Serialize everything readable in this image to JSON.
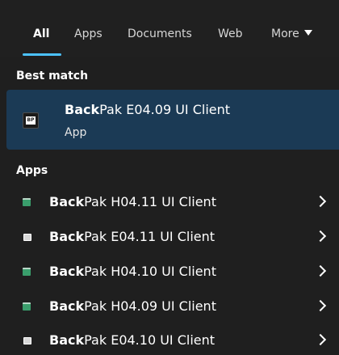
{
  "tabs": [
    {
      "label": "All",
      "active": true
    },
    {
      "label": "Apps",
      "active": false
    },
    {
      "label": "Documents",
      "active": false
    },
    {
      "label": "Web",
      "active": false
    },
    {
      "label": "More",
      "active": false
    }
  ],
  "best_match": {
    "header": "Best match",
    "title_bold": "Back",
    "title_rest": "Pak E04.09 UI Client",
    "subtitle": "App",
    "icon_text": "BP",
    "icon": "app-window-icon"
  },
  "apps": {
    "header": "Apps",
    "items": [
      {
        "bold": "Back",
        "rest": "Pak H04.11 UI Client",
        "icon": "green-app-icon"
      },
      {
        "bold": "Back",
        "rest": "Pak E04.11 UI Client",
        "icon": "mono-app-icon"
      },
      {
        "bold": "Back",
        "rest": "Pak H04.10 UI Client",
        "icon": "green-app-icon"
      },
      {
        "bold": "Back",
        "rest": "Pak H04.09 UI Client",
        "icon": "green-app-icon"
      },
      {
        "bold": "Back",
        "rest": "Pak E04.10 UI Client",
        "icon": "mono-app-icon"
      }
    ]
  },
  "colors": {
    "background": "#1f1f1f",
    "selection": "#1b3a55",
    "accent": "#4cc2ff",
    "green_icon": "#3a9e6c"
  }
}
